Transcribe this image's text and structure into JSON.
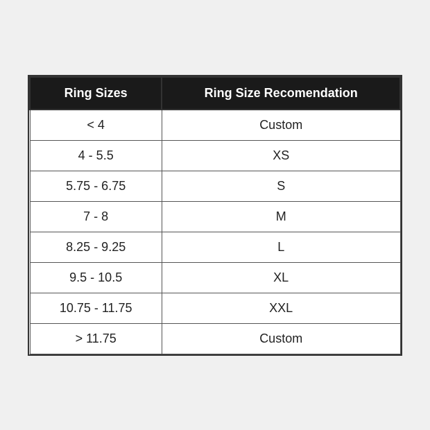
{
  "table": {
    "header": {
      "col1": "Ring Sizes",
      "col2": "Ring Size Recomendation"
    },
    "rows": [
      {
        "size": "< 4",
        "recommendation": "Custom"
      },
      {
        "size": "4 - 5.5",
        "recommendation": "XS"
      },
      {
        "size": "5.75 - 6.75",
        "recommendation": "S"
      },
      {
        "size": "7 - 8",
        "recommendation": "M"
      },
      {
        "size": "8.25 - 9.25",
        "recommendation": "L"
      },
      {
        "size": "9.5 - 10.5",
        "recommendation": "XL"
      },
      {
        "size": "10.75 - 11.75",
        "recommendation": "XXL"
      },
      {
        "size": "> 11.75",
        "recommendation": "Custom"
      }
    ]
  }
}
